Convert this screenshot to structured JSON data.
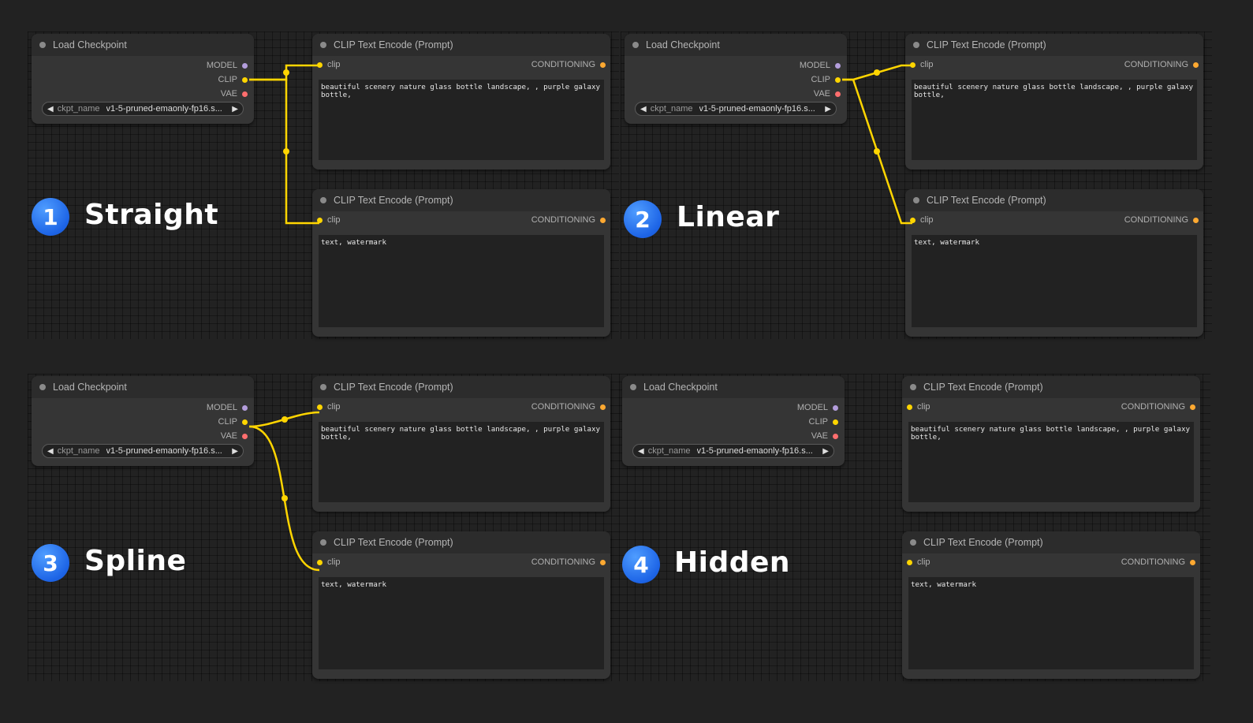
{
  "load_checkpoint": {
    "title": "Load Checkpoint",
    "outputs": {
      "model": "MODEL",
      "clip": "CLIP",
      "vae": "VAE"
    },
    "widget_name": "ckpt_name",
    "widget_value": "v1-5-pruned-emaonly-fp16.s...",
    "left_arrow": "◀",
    "right_arrow": "▶"
  },
  "clip_encode": {
    "title": "CLIP Text Encode (Prompt)",
    "input": "clip",
    "output": "CONDITIONING",
    "positive_text": "beautiful scenery nature glass bottle landscape, , purple galaxy bottle,",
    "negative_text": "text, watermark"
  },
  "panels": [
    {
      "number": "1",
      "label": "Straight"
    },
    {
      "number": "2",
      "label": "Linear"
    },
    {
      "number": "3",
      "label": "Spline"
    },
    {
      "number": "4",
      "label": "Hidden"
    }
  ],
  "colors": {
    "canvas": "#222222",
    "node_body": "#353535",
    "node_title": "#2c2c2c",
    "wire_clip": "#ffd500",
    "slot_model": "#b39ddb",
    "slot_vae": "#ff6e6e",
    "slot_conditioning": "#ffa931",
    "badge": "#1d64e6"
  },
  "icons": {
    "title_dot": "circle-dot-icon",
    "combo_left": "triangle-left-icon",
    "combo_right": "triangle-right-icon"
  }
}
